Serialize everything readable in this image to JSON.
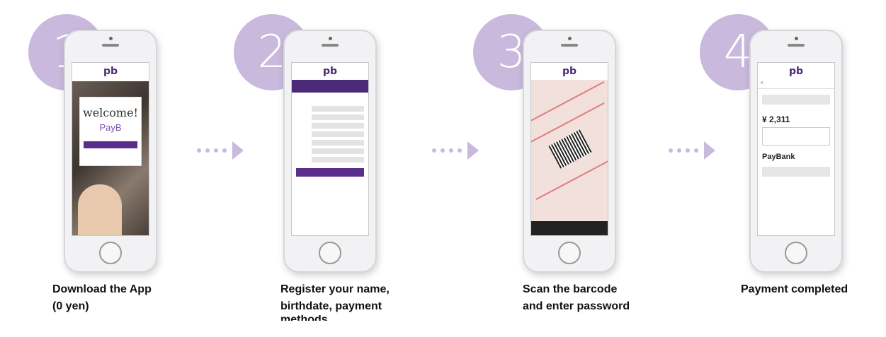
{
  "steps": [
    {
      "number": "1",
      "caption_line1": "Download the App",
      "caption_line2": "(0 yen)",
      "caption_line3": ""
    },
    {
      "number": "2",
      "caption_line1": "Register your name,",
      "caption_line2": "birthdate, payment",
      "caption_line3": "methods"
    },
    {
      "number": "3",
      "caption_line1": "Scan the barcode",
      "caption_line2": "and enter password",
      "caption_line3": ""
    },
    {
      "number": "4",
      "caption_line1": "Payment completed",
      "caption_line2": "",
      "caption_line3": ""
    }
  ],
  "screens": {
    "logo": "pb",
    "welcome": "welcome!",
    "brand": "PayB",
    "amount": "¥ 2,311",
    "bank": "PayBank"
  },
  "colors": {
    "accent": "#c9b9dc",
    "brand": "#4b2a78"
  }
}
